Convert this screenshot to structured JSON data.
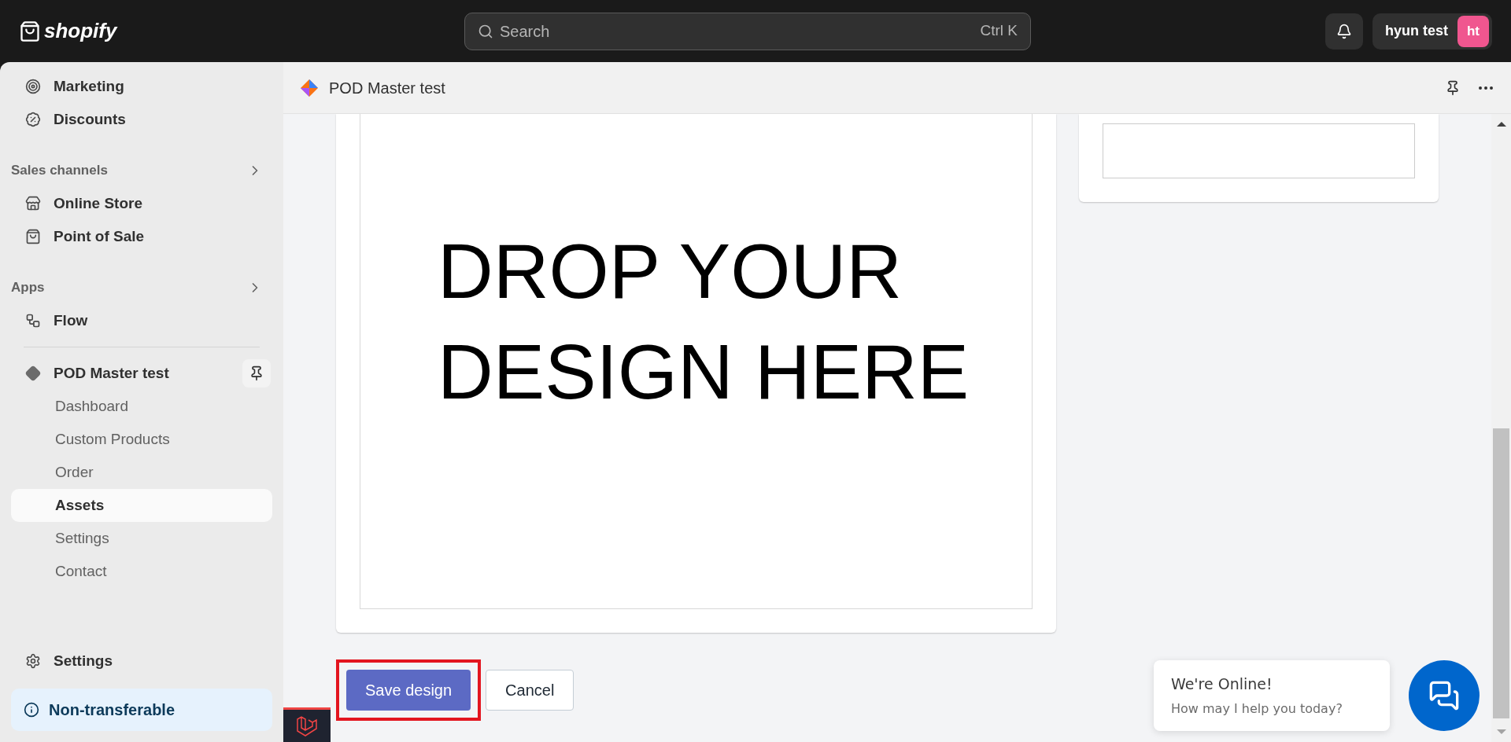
{
  "topbar": {
    "logo": "shopify",
    "search": {
      "placeholder": "Search",
      "shortcut": "Ctrl K"
    },
    "user": {
      "name": "hyun test",
      "initials": "ht"
    }
  },
  "sidebar": {
    "items": [
      {
        "label": "Marketing",
        "kind": "marketing"
      },
      {
        "label": "Discounts",
        "kind": "discounts"
      }
    ],
    "sections": [
      {
        "title": "Sales channels",
        "items": [
          {
            "label": "Online Store",
            "kind": "store"
          },
          {
            "label": "Point of Sale",
            "kind": "pos"
          }
        ]
      },
      {
        "title": "Apps",
        "items": [
          {
            "label": "Flow",
            "kind": "flow"
          }
        ]
      }
    ],
    "app": {
      "name": "POD Master test",
      "children": [
        {
          "label": "Dashboard",
          "selected": false
        },
        {
          "label": "Custom Products",
          "selected": false
        },
        {
          "label": "Order",
          "selected": false
        },
        {
          "label": "Assets",
          "selected": true
        },
        {
          "label": "Settings",
          "selected": false
        },
        {
          "label": "Contact",
          "selected": false
        }
      ]
    },
    "settings": "Settings",
    "notice": "Non-transferable"
  },
  "app_header": {
    "title": "POD Master test"
  },
  "canvas_text": "DROP YOUR DESIGN HERE",
  "buttons": [
    {
      "label": "Save design",
      "kind": "primary",
      "highlighted": true
    },
    {
      "label": "Cancel",
      "kind": "secondary",
      "highlighted": false
    }
  ],
  "chat": {
    "title": "We're Online!",
    "subtitle": "How may I help you today?"
  }
}
